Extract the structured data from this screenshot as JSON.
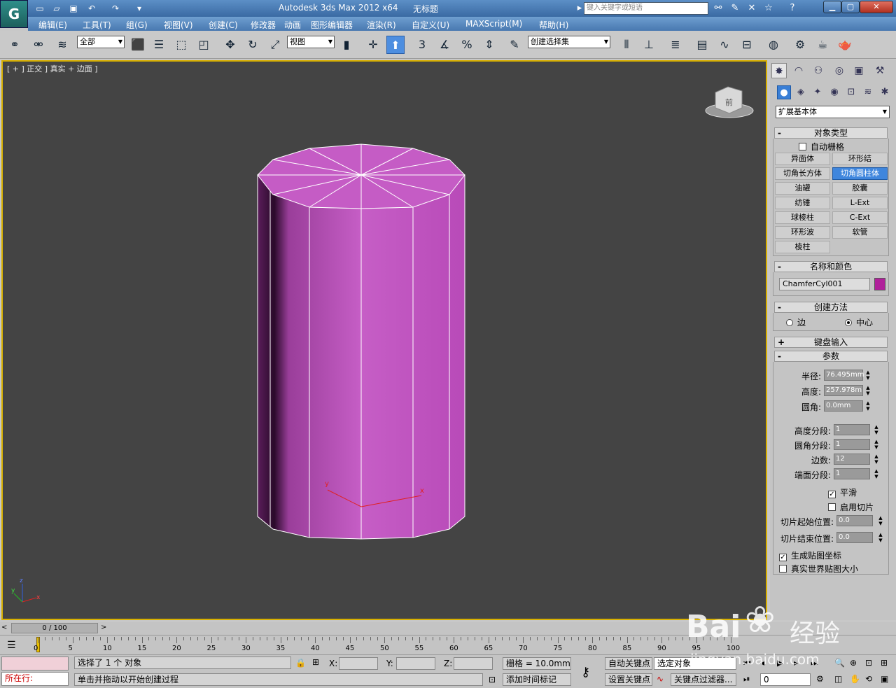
{
  "titlebar": {
    "app_title": "Autodesk 3ds Max  2012 x64",
    "doc_title": "无标题",
    "search_placeholder": "键入关键字或短语",
    "logo": "G"
  },
  "menu": [
    "编辑(E)",
    "工具(T)",
    "组(G)",
    "视图(V)",
    "创建(C)",
    "修改器",
    "动画",
    "图形编辑器",
    "渲染(R)",
    "自定义(U)",
    "MAXScript(M)",
    "帮助(H)"
  ],
  "toolbar": {
    "selection_filter": "全部",
    "ref_coord": "视图",
    "named_selection": "创建选择集",
    "snap_label": "3"
  },
  "viewport": {
    "label": "[ + ] 正交 ] 真实 + 边面 ]",
    "viewcube_label": "前",
    "axis_x": "x",
    "axis_y": "y",
    "axis_z": "z",
    "object_color": "#c050c0"
  },
  "panel": {
    "category": "扩展基本体",
    "object_type": {
      "title": "对象类型",
      "autogrid": "自动栅格",
      "buttons": [
        "异面体",
        "环形结",
        "切角长方体",
        "切角圆柱体",
        "油罐",
        "胶囊",
        "纺锤",
        "L-Ext",
        "球棱柱",
        "C-Ext",
        "环形波",
        "软管",
        "棱柱"
      ],
      "active_index": 3
    },
    "name_color": {
      "title": "名称和颜色",
      "name": "ChamferCyl001",
      "color": "#b0209a"
    },
    "creation_method": {
      "title": "创建方法",
      "edge": "边",
      "center": "中心"
    },
    "keyboard_entry": "键盘输入",
    "parameters": {
      "title": "参数",
      "radius_label": "半径:",
      "radius": "76.495mm",
      "height_label": "高度:",
      "height": "257.978m",
      "fillet_label": "圆角:",
      "fillet": "0.0mm",
      "height_segs_label": "高度分段:",
      "height_segs": "1",
      "fillet_segs_label": "圆角分段:",
      "fillet_segs": "1",
      "sides_label": "边数:",
      "sides": "12",
      "cap_segs_label": "端面分段:",
      "cap_segs": "1",
      "smooth": "平滑",
      "slice_on": "启用切片",
      "slice_from_label": "切片起始位置:",
      "slice_from": "0.0",
      "slice_to_label": "切片结束位置:",
      "slice_to": "0.0",
      "gen_map": "生成贴图坐标",
      "real_world": "真实世界贴图大小"
    }
  },
  "timeline": {
    "frame_display": "0 / 100",
    "ticks": [
      "0",
      "5",
      "10",
      "15",
      "20",
      "25",
      "30",
      "35",
      "40",
      "45",
      "50",
      "55",
      "60",
      "65",
      "70",
      "75",
      "80",
      "85",
      "90",
      "95",
      "100"
    ]
  },
  "status": {
    "maxscript": "所在行:",
    "selection": "选择了 1 个 对象",
    "prompt": "单击并拖动以开始创建过程",
    "x_label": "X:",
    "y_label": "Y:",
    "z_label": "Z:",
    "grid": "栅格 = 10.0mm",
    "add_time_tag": "添加时间标记",
    "auto_key": "自动关键点",
    "set_key": "设置关键点",
    "selected_dd": "选定对象",
    "key_filters": "关键点过滤器...",
    "frame_field": "0"
  },
  "watermark": {
    "brand": "Bai",
    "brand2": "经验",
    "url": "jingyan.baidu.com"
  }
}
